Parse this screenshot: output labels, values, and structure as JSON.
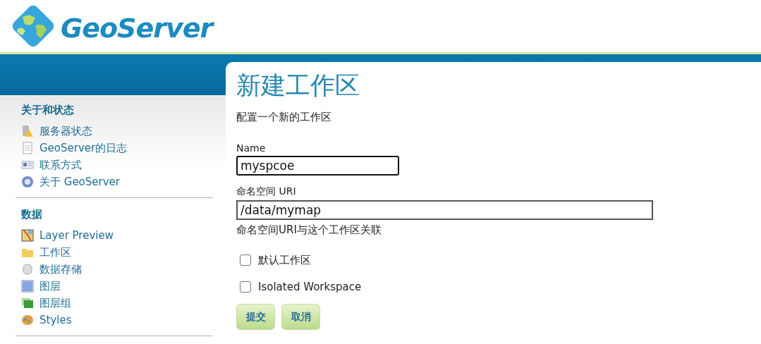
{
  "logo": {
    "text": "GeoServer"
  },
  "sidebar": {
    "sections": [
      {
        "title": "关于和状态",
        "items": [
          {
            "label": "服务器状态",
            "kind": "server"
          },
          {
            "label": "GeoServer的日志",
            "kind": "document"
          },
          {
            "label": "联系方式",
            "kind": "contact"
          },
          {
            "label": "关于 GeoServer",
            "kind": "help"
          }
        ]
      },
      {
        "title": "数据",
        "items": [
          {
            "label": "Layer Preview",
            "kind": "map"
          },
          {
            "label": "工作区",
            "kind": "folder"
          },
          {
            "label": "数据存储",
            "kind": "database"
          },
          {
            "label": "图层",
            "kind": "layer"
          },
          {
            "label": "图层组",
            "kind": "layergroup"
          },
          {
            "label": "Styles",
            "kind": "palette"
          }
        ]
      }
    ]
  },
  "page": {
    "title": "新建工作区",
    "subtitle": "配置一个新的工作区",
    "fields": [
      {
        "label": "Name",
        "value": "myspcoe",
        "focused": true,
        "kind": "short"
      },
      {
        "label": "命名空间 URI",
        "value": "/data/mymap",
        "focused": false,
        "kind": "long",
        "help": "命名空间URI与这个工作区关联"
      }
    ],
    "checkboxes": [
      {
        "label": "默认工作区",
        "checked": false
      },
      {
        "label": "Isolated Workspace",
        "checked": false
      }
    ],
    "buttons": [
      "提交",
      "取消"
    ]
  }
}
